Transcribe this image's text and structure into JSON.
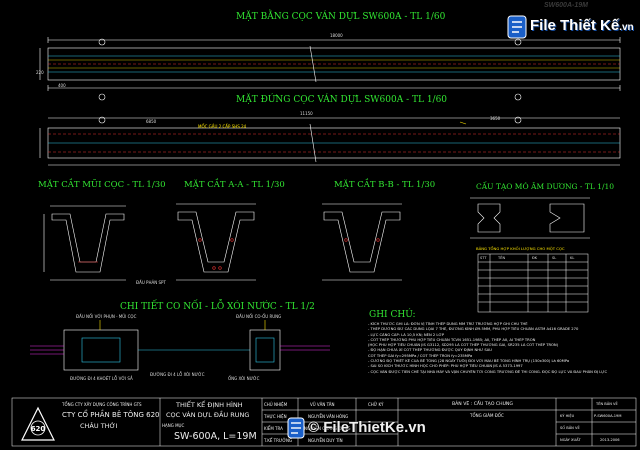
{
  "titles": {
    "plan": "MẶT BẰNG CỌC VÁN DỰL SW600A - TL 1/60",
    "elevation": "MẶT ĐỨNG CỌC VÁN DỰL SW600A - TL 1/60",
    "sec_tip": "MẶT CẮT MŨI CỌC - TL 1/30",
    "sec_a": "MẶT CẮT A-A - TL 1/30",
    "sec_b": "MẶT CẮT B-B - TL 1/30",
    "lift": "CẤU TẠO MÓ ÂM DƯƠNG - TL 1/10",
    "joint": "CHI TIẾT CO NỐI - LỖ XÓI NƯỚC - TL 1/2",
    "notes": "GHI CHÚ:"
  },
  "dims": {
    "plan_total": "18000",
    "elev_total": "11150",
    "elev_left": "6850",
    "elev_right": "3650",
    "plan_400": "400",
    "plan_220": "220"
  },
  "labels": {
    "steel_note": "MỐC GẦU 2 CẤP SHS 24",
    "table_title": "BẢNG TỔNG HỢP KHỐI LƯỢNG CHO MỘT CỌC",
    "table_head": [
      "STT",
      "TÊN",
      "ĐK",
      "SL",
      "KL"
    ],
    "joint_left": "ĐẦU NỐI VỚI PHỤN - MŨI CỌC",
    "joint_right": "ĐẦU NỐI CO-ỐU RUNG",
    "d1": "ĐƯỜNG ĐI 4 KHOÉT LỖ VỚI SẮ",
    "d2": "ĐƯỜNG ĐI 4 LỖ XÓI NƯỚC",
    "d3": "ỐNG XÓI NƯỚC",
    "d4": "ĐẦU PHẢN SPT"
  },
  "notes": [
    "- KÍCH THƯỚC GHI LÀ: ĐƠN VỊ TÍNH THÉP DÙNG MM TRỪ TRƯỜNG HỢP GHI CHÚ THÊ",
    "- THÉP DƯỜNG ĐỨ CÁC DÙNG LỌAI 7 THÉ, ĐƯỜNG KÍNH Ø9.5MM, PHỦ HỢP TIÊU CHUẨN ASTM A416 GRADE 270",
    "- LỰC CĂNG CÁP: LÀ 10,5 KN; NÉN 2 LỚP",
    "- CỐT THÉP THƯỜNG PHỦ HỢP TIÊU CHUẨN TCVN 1651-1985; AII, THÉP AII, AI THÉP TRÒN",
    "(HỌC PHÙ HỢP TIÊU CHUẨN JIS G3112, SD295 LÀ CỐT THÉP THƯỜNG GAI, SR235 LÀ CỐT THÉP TRÒN)",
    "- ĐỘ HẠN CHỮA XỈ CỐT THÉP THƯỜNG ĐƯỢC QUY ĐỊNH NHƯ SAU",
    "   CỐT THÉP GAI fy=295MPa / CỐT THÉP TRÒN fy=235MPa",
    "- CƯỜNG ĐỘ THIẾT KẾ CỦA BÊ TÔNG (28 NGÀY TUỔI) ĐỐI VỚI MẪU BÊ TÔNG HÌNH TRỤ (150x300) Là 60MPa",
    "- SAI SỐ KÍCH THƯỚC HÌNH HỌC CHO PHÉP: PHÙ HỢP TIÊU CHUẨN JIS A 5373-1997",
    "- CỌC VÁN ĐƯỢC TIỀN CHẾ TẠI NHÀ MÁY VÀ VẬN CHUYỂN TỚI CÔNG TRƯỜNG ĐỂ THI CÔNG. ĐỘC ĐỘ LỰC VÀ ĐẦU PHÂN ĐỊ LỰC"
  ],
  "title_block": {
    "company": "TỔNG CTY XÂY DỰNG CÔNG TRÌNH GTS",
    "company2": "CTY CỔ PHẦN BÊ TÔNG 620",
    "company3": "CHÂU THỚI",
    "logo_text": "620",
    "drawing1": "THIẾT KẾ ĐỊNH HÌNH",
    "drawing2": "CỌC VÁN DỰL ĐẦU RUNG",
    "drawing3": "SW-600A, L=19M",
    "hangmuc": "HẠNG MỤC",
    "role1": "CHỦ NHIỆM",
    "role2": "THỰC HIỆN",
    "role3": "KIỂM TRA",
    "role4": "T.KẾ TRƯỞNG",
    "name1": "VŨ VĂN TÂN",
    "name2": "NGUYỄN VĂN HÒNG",
    "name3": "NGUYỄN QUANG DŨNG",
    "name4": "NGUYỄN DUY TÍN",
    "sign": "CHỮ KÝ",
    "approve": "BẢN VẼ : CẤU TẠO CHUNG",
    "director": "TỔNG GIÁM ĐỐC",
    "r_head": "TÊN BẢN VẼ",
    "r_code": "P-SW600A-19M",
    "r_scale_label": "KÝ HIỆU",
    "r_sheet": "SỐ BẢN VẼ",
    "r_date_label": "NGÀY XUẤT",
    "r_date": "2013-2006"
  },
  "watermark": {
    "brand": "File Thiết Kế .vn",
    "brand_top": "File Thiết Kế",
    "brand_top_suffix": ".vn",
    "tagline": "© FileThietKe.vn",
    "top_ghost": "SW600A-19M"
  },
  "colors": {
    "background": "#000000",
    "title_green": "#32e632",
    "label_yellow": "#ffe600",
    "line_white": "#ffffff",
    "line_cyan": "#30c8e8",
    "line_red": "#e63232",
    "line_magenta": "#e632e6"
  }
}
